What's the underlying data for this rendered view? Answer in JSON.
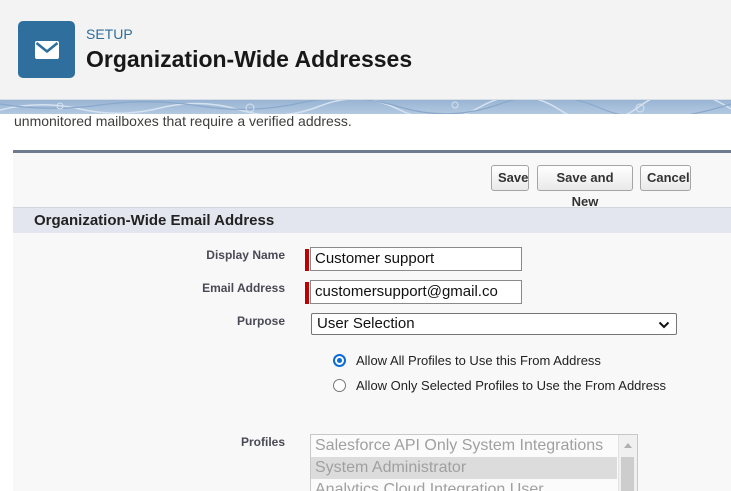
{
  "header": {
    "icon": "envelope-icon",
    "breadcrumb": "SETUP",
    "title": "Organization-Wide Addresses",
    "accent_color": "#2e6f9e"
  },
  "intro_text": "unmonitored mailboxes that require a verified address.",
  "toolbar": {
    "save_label": "Save",
    "save_new_label": "Save and New",
    "cancel_label": "Cancel"
  },
  "section": {
    "title": "Organization-Wide Email Address"
  },
  "form": {
    "display_name": {
      "label": "Display Name",
      "value": "Customer support"
    },
    "email_address": {
      "label": "Email Address",
      "value": "customersupport@gmail.co"
    },
    "purpose": {
      "label": "Purpose",
      "selected": "User Selection"
    },
    "profile_access": {
      "options": [
        {
          "label": "Allow All Profiles to Use this From Address",
          "checked": true
        },
        {
          "label": "Allow Only Selected Profiles to Use the From Address",
          "checked": false
        }
      ]
    },
    "profiles": {
      "label": "Profiles",
      "items": [
        "Salesforce API Only System Integrations",
        "System Administrator",
        "Analytics Cloud Integration User"
      ],
      "selected_index": 1
    }
  },
  "colors": {
    "required_marker": "#c00000",
    "radio_selected": "#0b6bd6"
  }
}
